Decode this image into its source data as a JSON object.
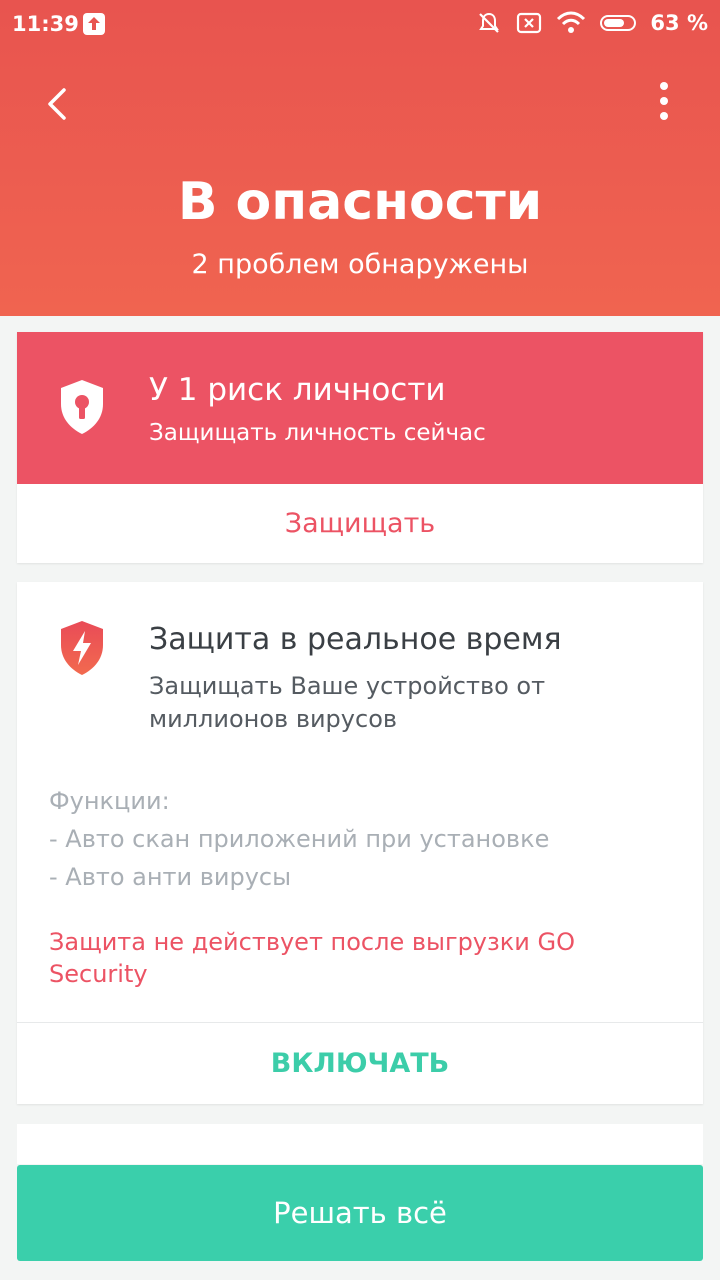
{
  "status_bar": {
    "time": "11:39",
    "battery": "63 %"
  },
  "header": {
    "title": "В опасности",
    "subtitle": "2 проблем обнаружены"
  },
  "identity_card": {
    "title": "У 1 риск личности",
    "subtitle": "Защищать личность сейчас",
    "action_label": "Защищать"
  },
  "realtime_card": {
    "title": "Защита в реальное время",
    "description": "Защищать Ваше устройство от миллионов вирусов",
    "features_heading": "Функции:",
    "features": [
      "- Авто скан приложений при установке",
      "- Авто анти вирусы"
    ],
    "warning": "Защита не действует после выгрузки GO Security",
    "action_label": "ВКЛЮЧАТЬ"
  },
  "bottom_button": {
    "label": "Решать всё"
  },
  "colors": {
    "header": "#e8544f",
    "danger": "#ec5364",
    "accent": "#3acfab"
  },
  "icons": [
    "back-arrow-icon",
    "more-vert-icon",
    "shield-keyhole-icon",
    "shield-lightning-icon",
    "upload-icon",
    "mute-icon",
    "sim-icon",
    "wifi-icon",
    "battery-icon"
  ]
}
